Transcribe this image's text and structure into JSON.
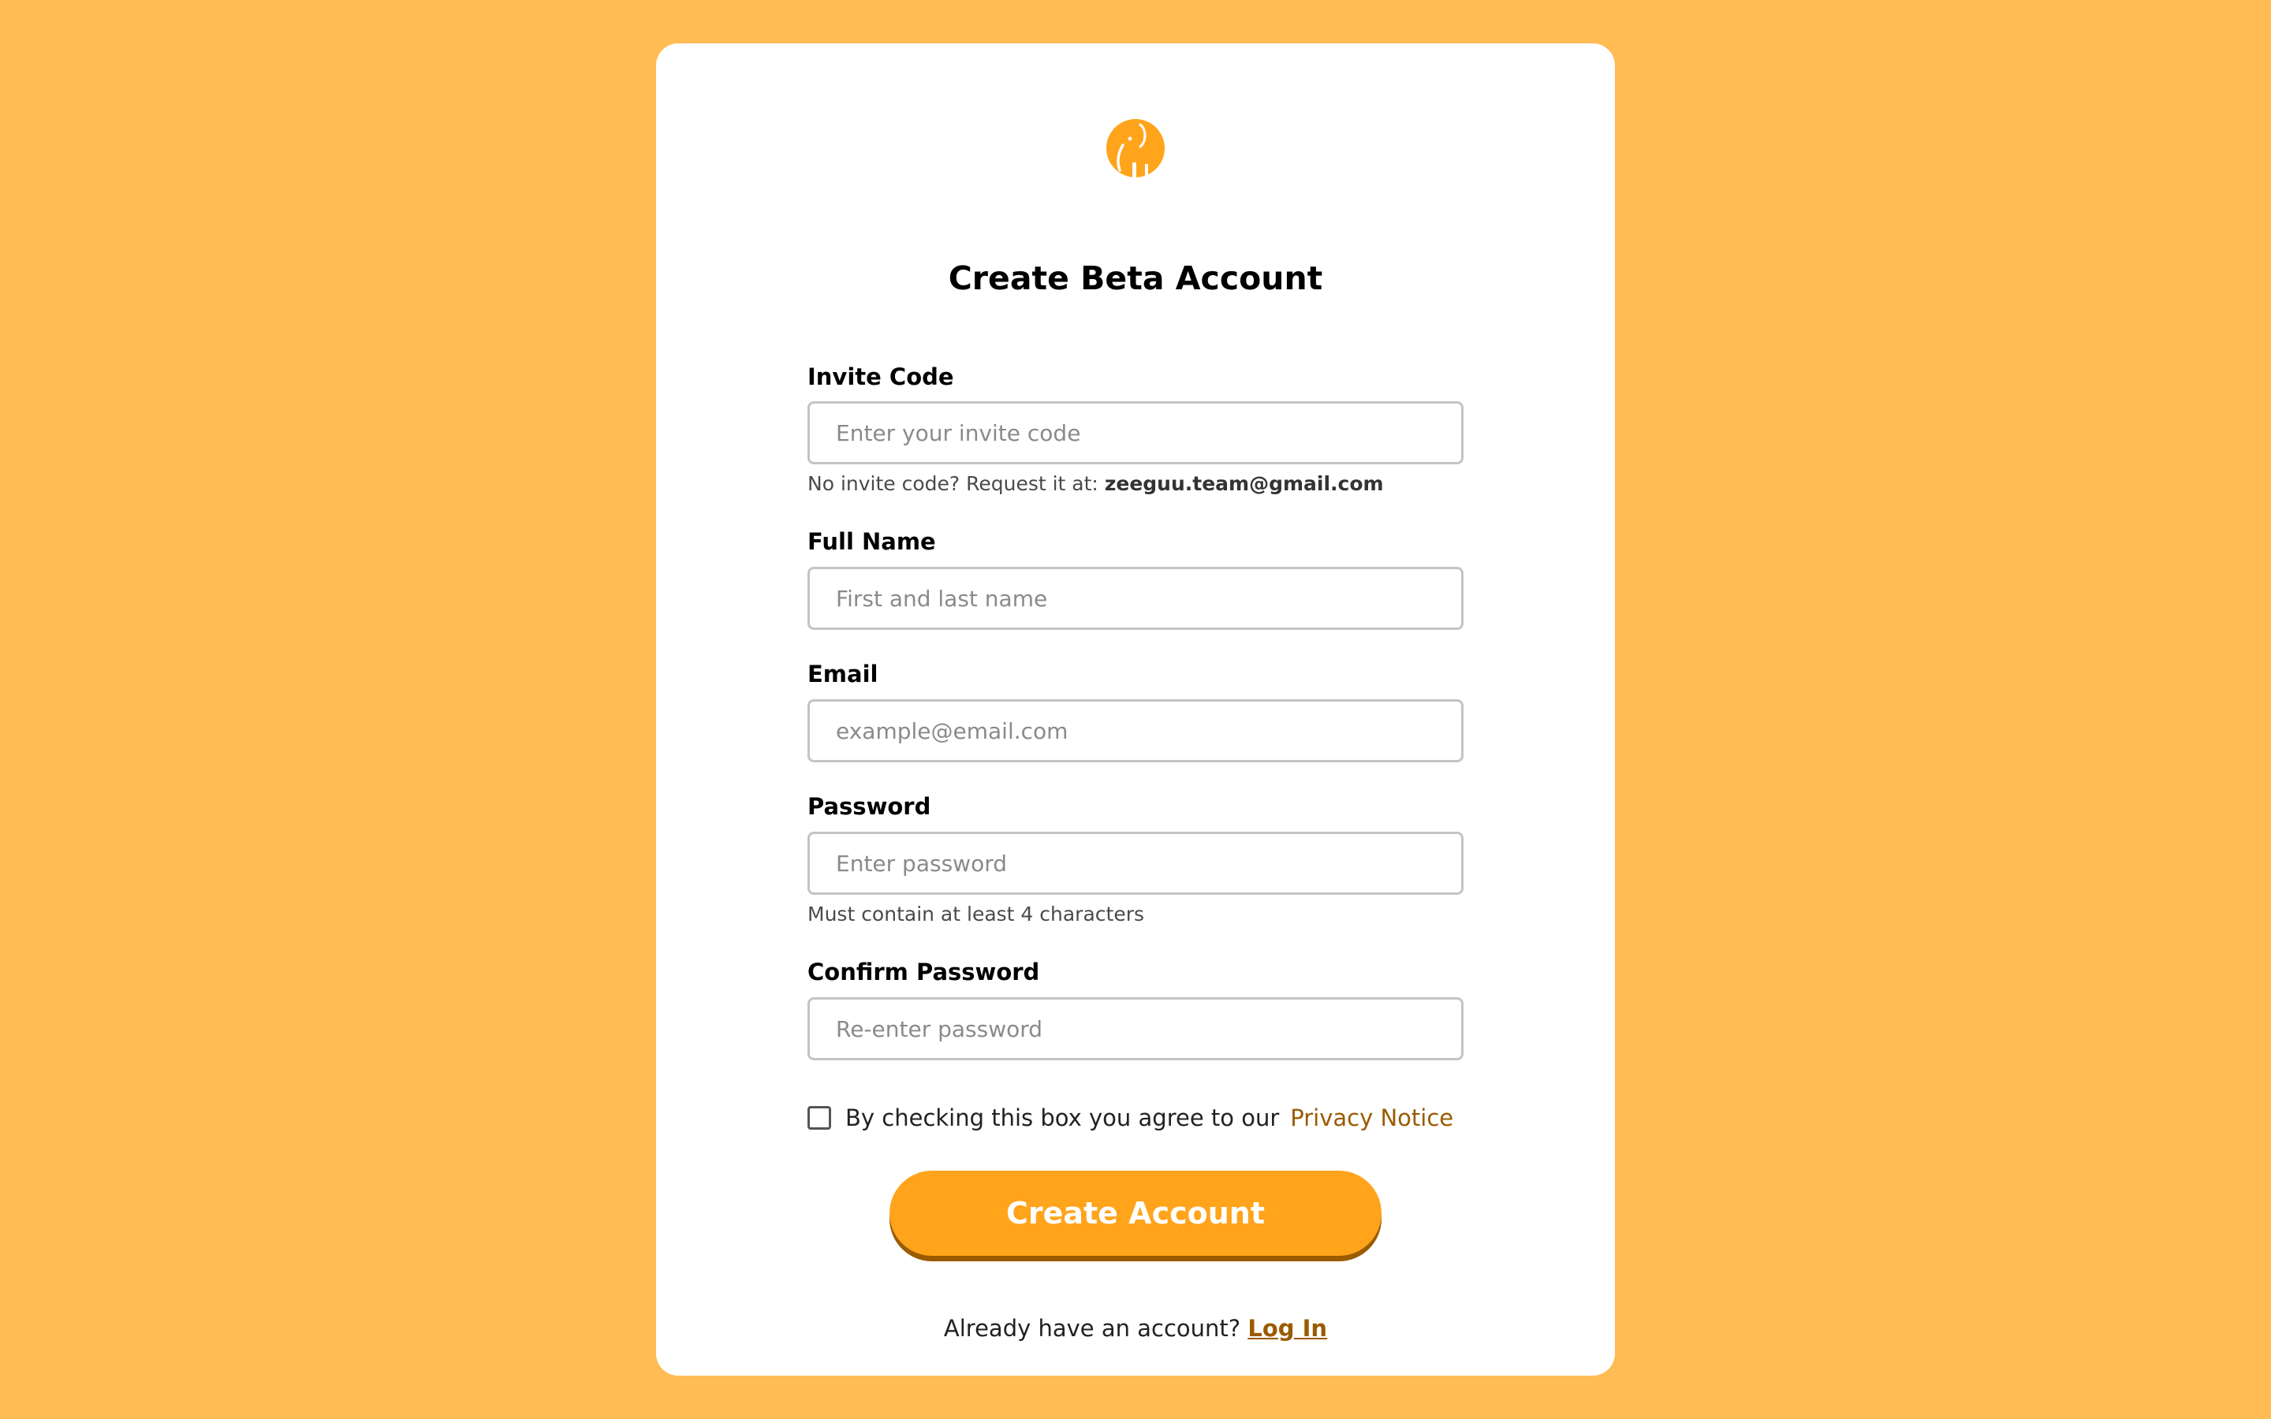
{
  "page": {
    "background_color": "#FFBB54",
    "accent_color": "#FFA41B",
    "link_color": "#9A5B00"
  },
  "header": {
    "logo_icon": "elephant-icon",
    "title": "Create Beta Account"
  },
  "form": {
    "invite_code": {
      "label": "Invite Code",
      "placeholder": "Enter your invite code",
      "value": "",
      "hint_prefix": "No invite code? Request it at:",
      "hint_email": "zeeguu.team@gmail.com"
    },
    "full_name": {
      "label": "Full Name",
      "placeholder": "First and last name",
      "value": ""
    },
    "email": {
      "label": "Email",
      "placeholder": "example@email.com",
      "value": ""
    },
    "password": {
      "label": "Password",
      "placeholder": "Enter password",
      "value": "",
      "hint": "Must contain at least 4 characters"
    },
    "confirm_password": {
      "label": "Confirm Password",
      "placeholder": "Re-enter password",
      "value": ""
    },
    "consent": {
      "checked": false,
      "text": "By checking this box you agree to our",
      "link_label": "Privacy Notice"
    },
    "submit_label": "Create Account"
  },
  "footer": {
    "prompt": "Already have an account?",
    "login_label": "Log In"
  }
}
